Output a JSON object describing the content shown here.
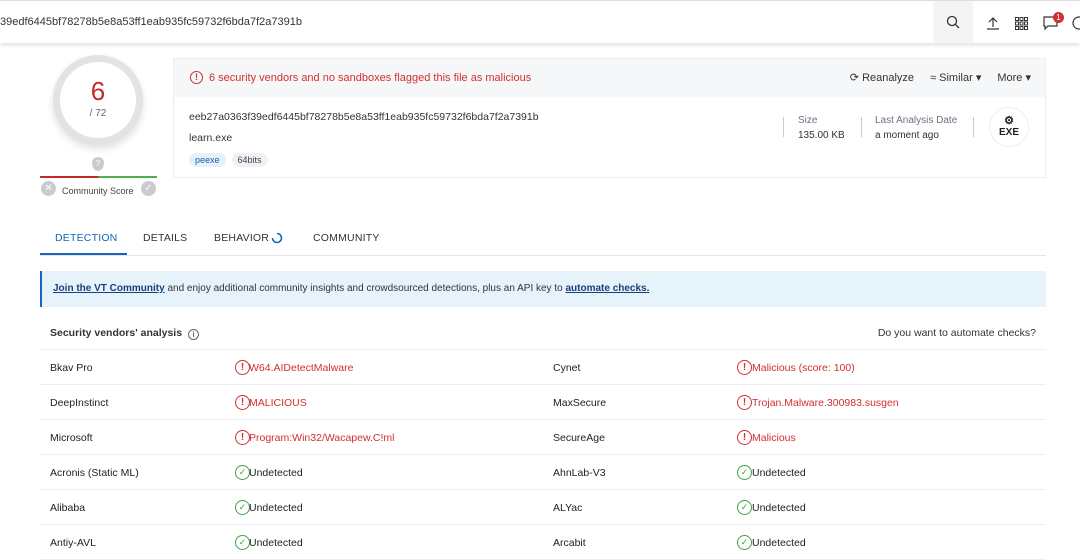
{
  "topbar": {
    "search_value": "39edf6445bf78278b5e8a53ff1eab935fc59732f6bda7f2a7391b",
    "notification_count": "1"
  },
  "score": {
    "detections": "6",
    "total": "/ 72",
    "community_label": "Community Score"
  },
  "file": {
    "alert": "6 security vendors and no sandboxes flagged this file as malicious",
    "actions": {
      "reanalyze": "Reanalyze",
      "similar": "Similar",
      "more": "More"
    },
    "hash": "eeb27a0363f39edf6445bf78278b5e8a53ff1eab935fc59732f6bda7f2a7391b",
    "name": "learn.exe",
    "tags": [
      "peexe",
      "64bits"
    ],
    "size_label": "Size",
    "size": "135.00 KB",
    "date_label": "Last Analysis Date",
    "date": "a moment ago",
    "type_badge": "EXE"
  },
  "tabs": [
    "DETECTION",
    "DETAILS",
    "BEHAVIOR",
    "COMMUNITY"
  ],
  "banner": {
    "link": "Join the VT Community",
    "text": " and enjoy additional community insights and crowdsourced detections, plus an API key to ",
    "link2": "automate checks."
  },
  "analysis": {
    "title": "Security vendors' analysis",
    "automate_question": "Do you want to automate checks?",
    "rows": [
      [
        {
          "vendor": "Bkav Pro",
          "result": "W64.AIDetectMalware",
          "malicious": true
        },
        {
          "vendor": "Cynet",
          "result": "Malicious (score: 100)",
          "malicious": true
        }
      ],
      [
        {
          "vendor": "DeepInstinct",
          "result": "MALICIOUS",
          "malicious": true
        },
        {
          "vendor": "MaxSecure",
          "result": "Trojan.Malware.300983.susgen",
          "malicious": true
        }
      ],
      [
        {
          "vendor": "Microsoft",
          "result": "Program:Win32/Wacapew.C!ml",
          "malicious": true
        },
        {
          "vendor": "SecureAge",
          "result": "Malicious",
          "malicious": true
        }
      ],
      [
        {
          "vendor": "Acronis (Static ML)",
          "result": "Undetected",
          "malicious": false
        },
        {
          "vendor": "AhnLab-V3",
          "result": "Undetected",
          "malicious": false
        }
      ],
      [
        {
          "vendor": "Alibaba",
          "result": "Undetected",
          "malicious": false
        },
        {
          "vendor": "ALYac",
          "result": "Undetected",
          "malicious": false
        }
      ],
      [
        {
          "vendor": "Antiy-AVL",
          "result": "Undetected",
          "malicious": false
        },
        {
          "vendor": "Arcabit",
          "result": "Undetected",
          "malicious": false
        }
      ]
    ]
  }
}
